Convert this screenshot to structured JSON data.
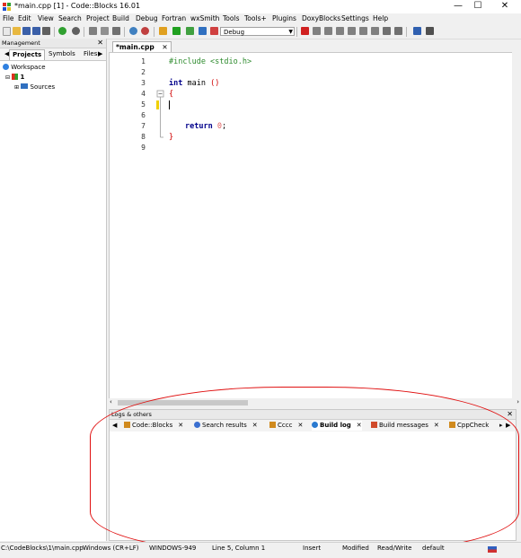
{
  "window": {
    "title": "*main.cpp [1] - Code::Blocks 16.01",
    "controls": [
      "—",
      "☐",
      "✕"
    ]
  },
  "menu": [
    "File",
    "Edit",
    "View",
    "Search",
    "Project",
    "Build",
    "Debug",
    "Fortran",
    "wxSmith",
    "Tools",
    "Tools+",
    "Plugins",
    "DoxyBlocks",
    "Settings",
    "Help"
  ],
  "toolbar": {
    "build_target": "Debug"
  },
  "management": {
    "title": "Management",
    "close": "✕",
    "tabs": [
      "Projects",
      "Symbols",
      "Files"
    ],
    "tab_arrow": "▶",
    "tree": {
      "workspace": "Workspace",
      "project": "1",
      "folder": "Sources"
    }
  },
  "editor": {
    "tab": "*main.cpp",
    "tab_close": "✕",
    "line_numbers": [
      "1",
      "2",
      "3",
      "4",
      "5",
      "6",
      "7",
      "8",
      "9"
    ],
    "code": {
      "l1": "#include <stdio.h>",
      "l3_kw": "int",
      "l3_rest": " main ",
      "l3_paren": "()",
      "l4": "{",
      "l7_kw": "return",
      "l7_num": " 0",
      "l7_semi": ";",
      "l8": "}"
    }
  },
  "logs": {
    "title": "Logs & others",
    "close": "✕",
    "tabs": [
      {
        "label": "Code::Blocks",
        "color": "#d08a1e"
      },
      {
        "label": "Search results",
        "color": "#3a6fd0"
      },
      {
        "label": "Cccc",
        "color": "#d08a1e"
      },
      {
        "label": "Build log",
        "color": "#2a7ad0"
      },
      {
        "label": "Build messages",
        "color": "#d04a2a"
      },
      {
        "label": "CppCheck",
        "color": "#d08a1e"
      }
    ],
    "tab_close": "✕",
    "scroll_left": "◀",
    "scroll_right": "▶",
    "scroll_more": "▸"
  },
  "status": {
    "path": "C:\\CodeBlocks\\1\\main.cpp",
    "eol": "Windows (CR+LF)",
    "encoding": "WINDOWS-949",
    "position": "Line 5, Column 1",
    "mode": "Insert",
    "modified": "Modified",
    "access": "Read/Write",
    "profile": "default"
  },
  "colors": {
    "highlight": "#e01010",
    "keyword": "#00008b",
    "preprocessor": "#2e8b2e"
  }
}
